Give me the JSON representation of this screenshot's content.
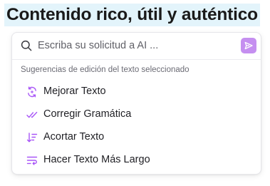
{
  "headline": {
    "text": "Contenido rico, útil y auténtico"
  },
  "prompt": {
    "placeholder": "Escriba su solicitud a AI ...",
    "value": ""
  },
  "suggestions": {
    "heading": "Sugerencias de edición del texto seleccionado",
    "items": [
      {
        "label": "Mejorar Texto",
        "icon": "sparkle-refresh-icon"
      },
      {
        "label": "Corregir Gramática",
        "icon": "double-check-icon"
      },
      {
        "label": "Acortar Texto",
        "icon": "shorten-lines-icon"
      },
      {
        "label": "Hacer Texto Más Largo",
        "icon": "lengthen-lines-icon"
      }
    ]
  },
  "colors": {
    "accent": "#a855f7",
    "send_button": "#c58ff0",
    "headline_highlight": "#e3f4fb"
  }
}
